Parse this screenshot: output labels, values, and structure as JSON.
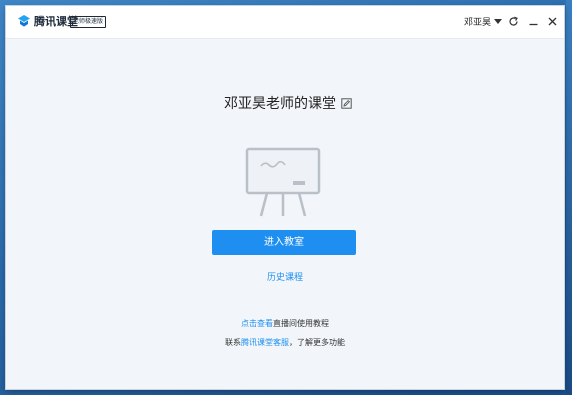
{
  "app": {
    "title": "腾讯课堂",
    "edition_badge": "老师极速版",
    "user_name": "邓亚昊"
  },
  "titlebar": {
    "refresh_icon": "refresh-icon",
    "minimize_icon": "minimize-icon",
    "close_icon": "close-icon"
  },
  "main": {
    "classroom_title": "邓亚昊老师的课堂",
    "enter_button": "进入教室",
    "history_link": "历史课程",
    "help": {
      "line1_link": "点击查看",
      "line1_text": "直播间使用教程",
      "line2_prefix": "联系",
      "line2_link": "腾讯课堂客服",
      "line2_suffix": "，了解更多功能"
    }
  },
  "colors": {
    "accent": "#1e8ff0",
    "background": "#f2f6fa",
    "text": "#222222"
  }
}
